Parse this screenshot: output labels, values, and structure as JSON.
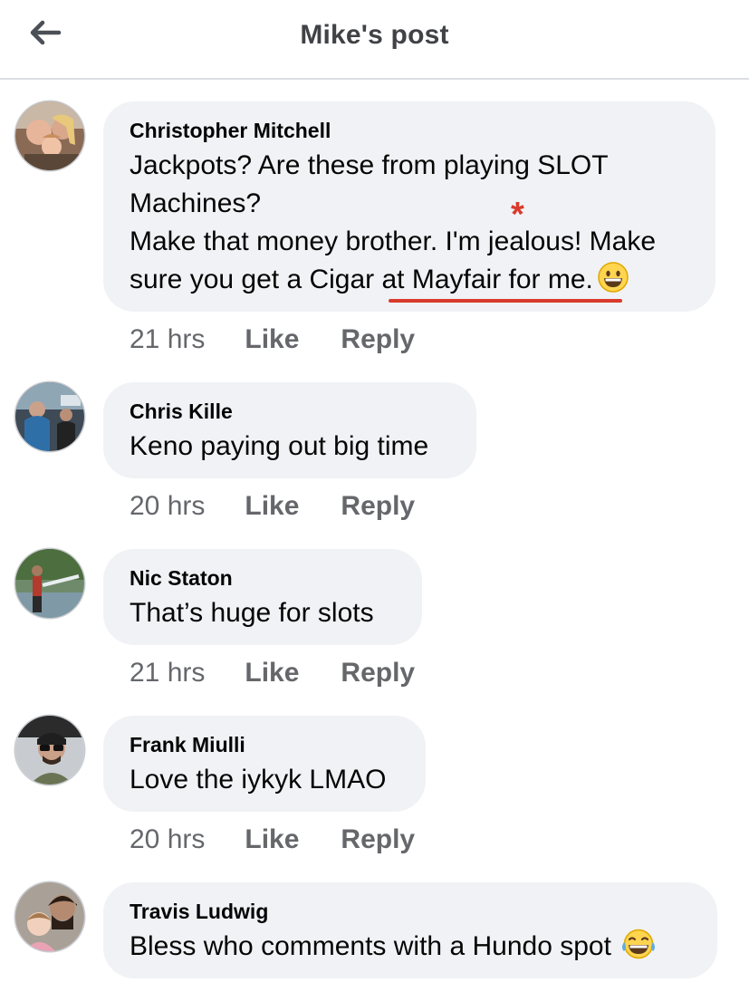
{
  "header": {
    "title": "Mike's post",
    "back_icon": "arrow-left-icon"
  },
  "comments": [
    {
      "author": "Christopher Mitchell",
      "lines": [
        "Jackpots? Are these from playing SLOT Machines?",
        "Make that money brother. I'm jealous! Make sure you get a Cigar at Mayfair for me."
      ],
      "time": "21 hrs",
      "like": "Like",
      "reply": "Reply",
      "emoji": "grinning-face-emoji"
    },
    {
      "author": "Chris Kille",
      "text": "Keno paying out big time",
      "time": "20 hrs",
      "like": "Like",
      "reply": "Reply"
    },
    {
      "author": "Nic Staton",
      "text": "That’s huge for slots",
      "time": "21 hrs",
      "like": "Like",
      "reply": "Reply"
    },
    {
      "author": "Frank Miulli",
      "text": "Love the iykyk LMAO",
      "time": "20 hrs",
      "like": "Like",
      "reply": "Reply"
    },
    {
      "author": "Travis Ludwig",
      "text": "Bless who comments with a Hundo spot",
      "emoji": "tears-of-joy-emoji"
    }
  ],
  "annotation": {
    "mark": "*",
    "color": "#d93b2c"
  },
  "colors": {
    "bubble": "#f0f2f5",
    "secondary_text": "#65676b",
    "annotation": "#d93b2c"
  }
}
